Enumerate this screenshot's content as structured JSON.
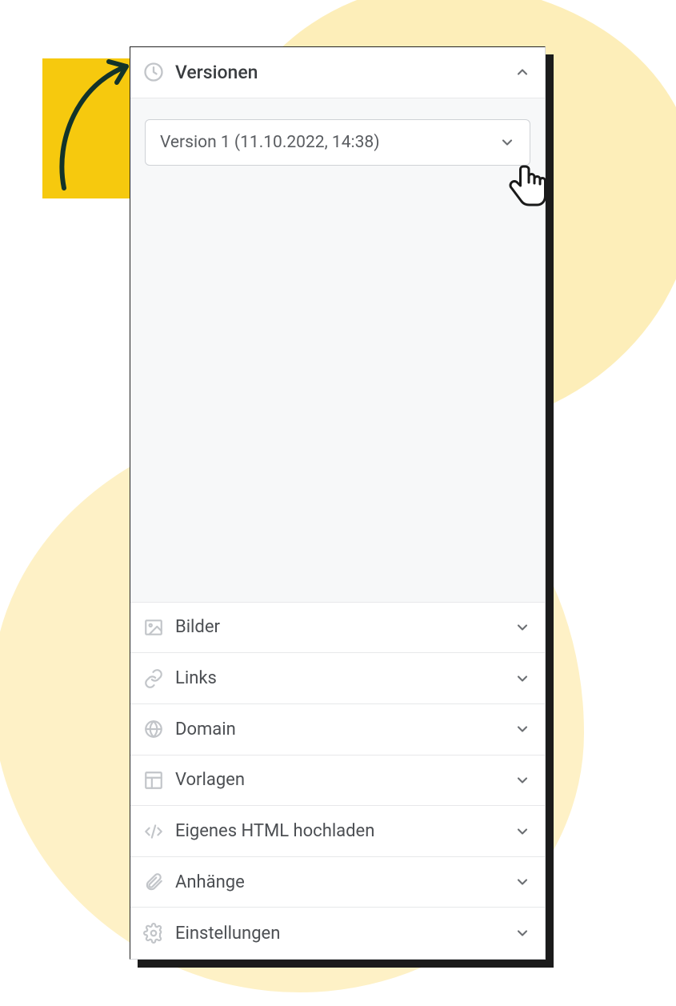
{
  "sections": {
    "versions": {
      "label": "Versionen",
      "expanded": true
    },
    "images": {
      "label": "Bilder"
    },
    "links": {
      "label": "Links"
    },
    "domain": {
      "label": "Domain"
    },
    "templates": {
      "label": "Vorlagen"
    },
    "html": {
      "label": "Eigenes HTML hochladen"
    },
    "attach": {
      "label": "Anhänge"
    },
    "settings": {
      "label": "Einstellungen"
    }
  },
  "version_select": {
    "selected": "Version 1 (11.10.2022, 14:38)"
  }
}
